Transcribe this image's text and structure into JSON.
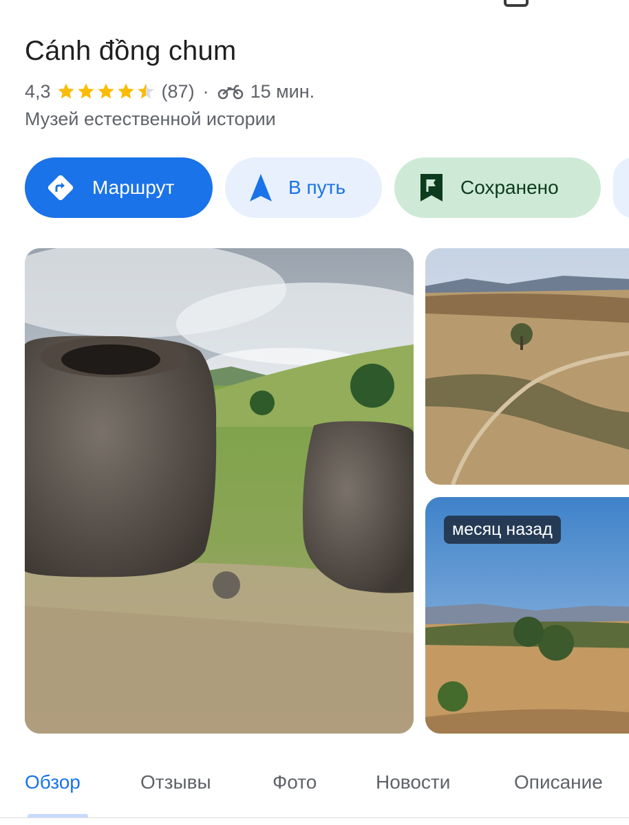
{
  "place": {
    "title": "Cánh đồng chum",
    "rating": "4,3",
    "rating_value": 4.3,
    "reviews_count": "(87)",
    "separator": "·",
    "travel_time": "15 мин.",
    "category": "Музей естественной истории"
  },
  "actions": {
    "route": "Маршрут",
    "start": "В путь",
    "saved": "Сохранено"
  },
  "photos": {
    "badge": "месяц назад"
  },
  "tabs": {
    "overview": "Обзор",
    "reviews": "Отзывы",
    "photos": "Фото",
    "news": "Новости",
    "description": "Описание"
  },
  "colors": {
    "accent": "#1a73e8",
    "star": "#fbbc04",
    "saved_bg": "#ceead6"
  },
  "icons": {
    "route": "directions-icon",
    "start": "navigation-arrow-icon",
    "saved": "bookmark-flag-icon",
    "travel_mode": "motorcycle-icon"
  }
}
